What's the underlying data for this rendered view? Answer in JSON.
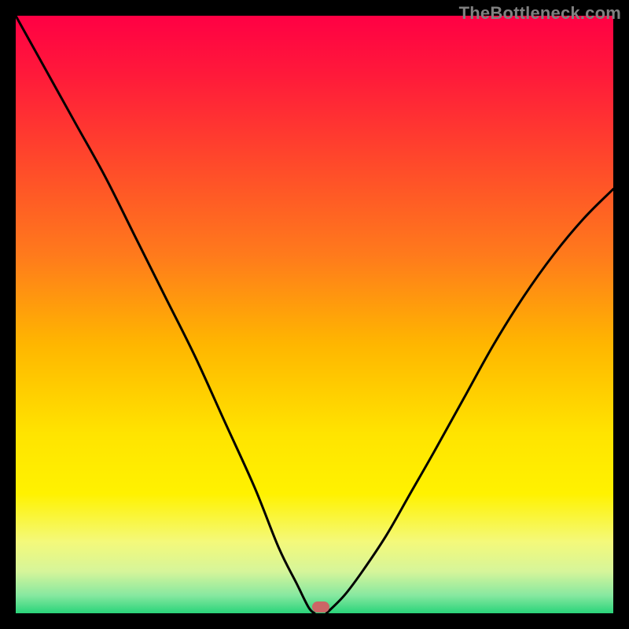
{
  "watermark": "TheBottleneck.com",
  "colors": {
    "frame": "#000000",
    "curve": "#000000",
    "marker": "#cc6666",
    "gradient_stops": [
      {
        "offset": 0.0,
        "color": "#ff0044"
      },
      {
        "offset": 0.1,
        "color": "#ff1a3a"
      },
      {
        "offset": 0.25,
        "color": "#ff4a2a"
      },
      {
        "offset": 0.4,
        "color": "#ff7a1c"
      },
      {
        "offset": 0.55,
        "color": "#ffb600"
      },
      {
        "offset": 0.7,
        "color": "#ffe400"
      },
      {
        "offset": 0.8,
        "color": "#fff200"
      },
      {
        "offset": 0.88,
        "color": "#f4f97a"
      },
      {
        "offset": 0.93,
        "color": "#d6f59a"
      },
      {
        "offset": 0.97,
        "color": "#87e8a0"
      },
      {
        "offset": 1.0,
        "color": "#2ad47a"
      }
    ]
  },
  "chart_data": {
    "type": "line",
    "title": "",
    "xlabel": "",
    "ylabel": "",
    "xlim": [
      0,
      100
    ],
    "ylim": [
      0,
      100
    ],
    "legend": false,
    "grid": false,
    "series": [
      {
        "name": "bottleneck-curve-left",
        "x": [
          0,
          5,
          10,
          15,
          20,
          25,
          30,
          35,
          40,
          44,
          47,
          49,
          50
        ],
        "y": [
          100,
          91,
          82,
          73,
          63,
          53,
          43,
          32,
          21,
          11,
          5,
          1,
          0
        ]
      },
      {
        "name": "bottleneck-curve-right",
        "x": [
          52,
          55,
          58,
          62,
          66,
          70,
          75,
          80,
          85,
          90,
          95,
          100
        ],
        "y": [
          0,
          3,
          7,
          13,
          20,
          27,
          36,
          45,
          53,
          60,
          66,
          71
        ]
      }
    ],
    "annotations": [
      {
        "name": "optimal-marker",
        "x": 51,
        "y": 1
      }
    ]
  }
}
